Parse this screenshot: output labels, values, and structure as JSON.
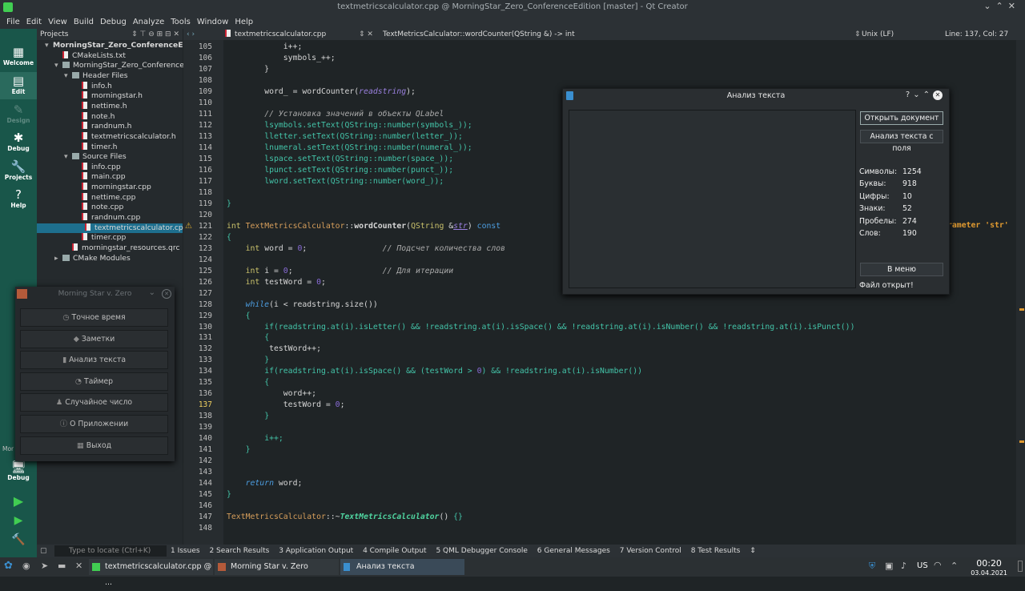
{
  "window": {
    "title": "textmetricscalculator.cpp @ MorningStar_Zero_ConferenceEdition [master] - Qt Creator"
  },
  "menu": [
    "File",
    "Edit",
    "View",
    "Build",
    "Debug",
    "Analyze",
    "Tools",
    "Window",
    "Help"
  ],
  "modes": [
    {
      "label": "Welcome",
      "icon": "welcome-icon"
    },
    {
      "label": "Edit",
      "icon": "edit-icon"
    },
    {
      "label": "Design",
      "icon": "design-icon"
    },
    {
      "label": "Debug",
      "icon": "debug-icon"
    },
    {
      "label": "Projects",
      "icon": "projects-icon"
    },
    {
      "label": "Help",
      "icon": "help-icon"
    }
  ],
  "kit": {
    "label": "Mor",
    "mode": "Debug"
  },
  "projects": {
    "header": "Projects",
    "tree": [
      {
        "label": "MorningStar_Zero_ConferenceE",
        "indent": 0,
        "kind": "project"
      },
      {
        "label": "CMakeLists.txt",
        "indent": 1,
        "kind": "file"
      },
      {
        "label": "MorningStar_Zero_ConferenceEd",
        "indent": 1,
        "kind": "target"
      },
      {
        "label": "Header Files",
        "indent": 2,
        "kind": "folder"
      },
      {
        "label": "info.h",
        "indent": 3,
        "kind": "file"
      },
      {
        "label": "morningstar.h",
        "indent": 3,
        "kind": "file"
      },
      {
        "label": "nettime.h",
        "indent": 3,
        "kind": "file"
      },
      {
        "label": "note.h",
        "indent": 3,
        "kind": "file"
      },
      {
        "label": "randnum.h",
        "indent": 3,
        "kind": "file"
      },
      {
        "label": "textmetricscalculator.h",
        "indent": 3,
        "kind": "file"
      },
      {
        "label": "timer.h",
        "indent": 3,
        "kind": "file"
      },
      {
        "label": "Source Files",
        "indent": 2,
        "kind": "folder"
      },
      {
        "label": "info.cpp",
        "indent": 3,
        "kind": "file"
      },
      {
        "label": "main.cpp",
        "indent": 3,
        "kind": "file"
      },
      {
        "label": "morningstar.cpp",
        "indent": 3,
        "kind": "file"
      },
      {
        "label": "nettime.cpp",
        "indent": 3,
        "kind": "file"
      },
      {
        "label": "note.cpp",
        "indent": 3,
        "kind": "file"
      },
      {
        "label": "randnum.cpp",
        "indent": 3,
        "kind": "file"
      },
      {
        "label": "textmetricscalculator.cpp",
        "indent": 3,
        "kind": "file",
        "selected": true
      },
      {
        "label": "timer.cpp",
        "indent": 3,
        "kind": "file"
      },
      {
        "label": "morningstar_resources.qrc",
        "indent": 2,
        "kind": "file"
      },
      {
        "label": "CMake Modules",
        "indent": 1,
        "kind": "folder"
      }
    ]
  },
  "editor": {
    "file_tab": "textmetricscalculator.cpp",
    "symbol": "TextMetricsCalculator::wordCounter(QString &) -> int",
    "line_ending": "Unix (LF)",
    "position": "Line: 137, Col: 27",
    "warning_text": "rameter 'str'",
    "current_line": 137
  },
  "output_tabs": [
    "1 Issues",
    "2 Search Results",
    "3 Application Output",
    "4 Compile Output",
    "5 QML Debugger Console",
    "6 General Messages",
    "7 Version Control",
    "8 Test Results"
  ],
  "locate_placeholder": "Type to locate (Ctrl+K)",
  "dialog": {
    "title": "Анализ текста",
    "open_button": "Открыть документ",
    "analyze_button": "Анализ текста с поля",
    "stats": [
      {
        "label": "Символы:",
        "value": "1254"
      },
      {
        "label": "Буквы:",
        "value": "918"
      },
      {
        "label": "Цифры:",
        "value": "10"
      },
      {
        "label": "Знаки:",
        "value": "52"
      },
      {
        "label": "Пробелы:",
        "value": "274"
      },
      {
        "label": "Слов:",
        "value": "190"
      }
    ],
    "menu_button": "В меню",
    "status": "Файл открыт!"
  },
  "morningstar": {
    "title": "Morning Star v. Zero",
    "buttons": [
      "Точное время",
      "Заметки",
      "Анализ текста",
      "Таймер",
      "Случайное число",
      "О Приложении",
      "Выход"
    ]
  },
  "taskbar": {
    "tasks": [
      "textmetricscalculator.cpp @ ...",
      "Morning Star v. Zero",
      "Анализ текста"
    ],
    "layout": "US",
    "time": "00:20",
    "date": "03.04.2021"
  }
}
